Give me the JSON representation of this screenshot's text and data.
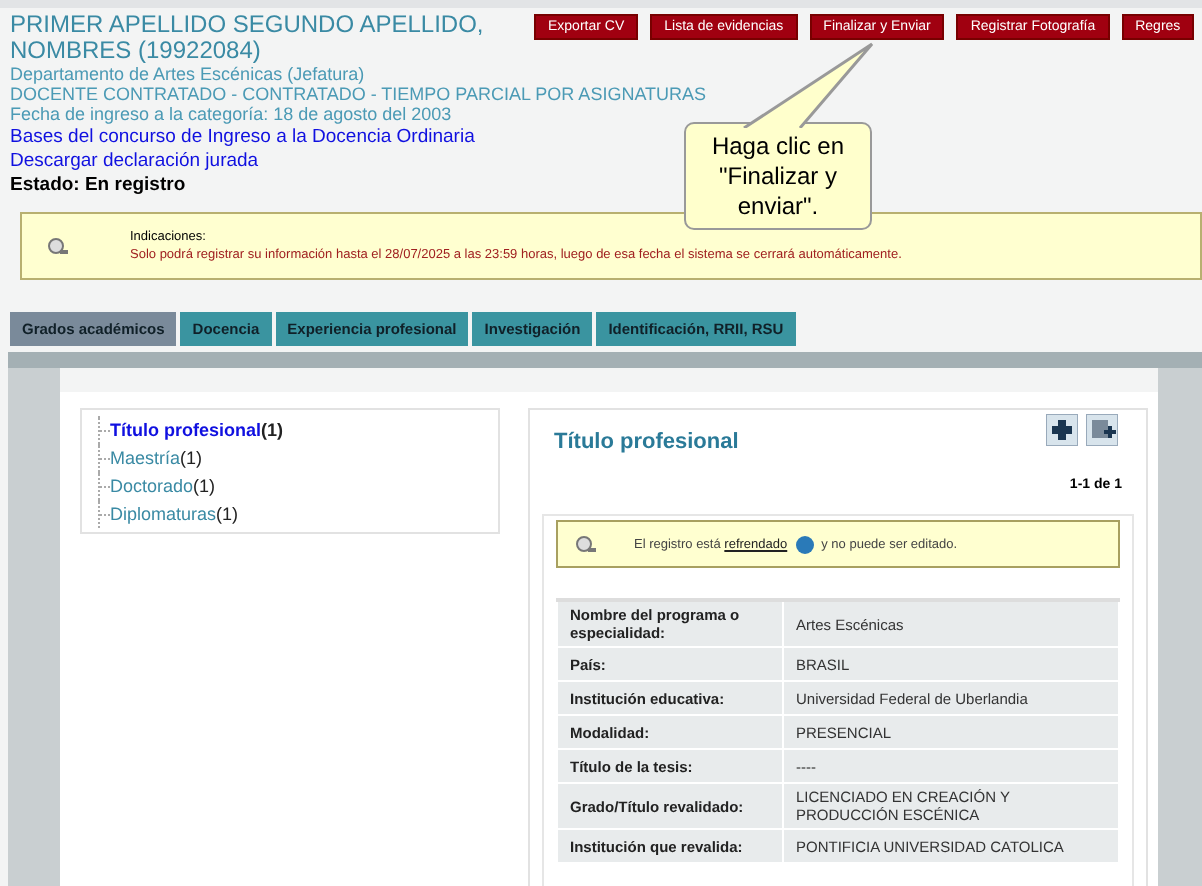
{
  "header": {
    "name": "PRIMER APELLIDO SEGUNDO APELLIDO, NOMBRES (19922084)",
    "department": "Departamento de Artes Escénicas (Jefatura)",
    "position": "DOCENTE CONTRATADO - CONTRATADO - TIEMPO PARCIAL POR ASIGNATURAS",
    "entry_date": "Fecha de ingreso a la categoría: 18 de agosto del 2003",
    "links": [
      "Bases del concurso de Ingreso a la Docencia Ordinaria",
      "Descargar declaración jurada"
    ],
    "status": "Estado: En registro"
  },
  "buttons": [
    "Exportar CV",
    "Lista de evidencias",
    "Finalizar y Enviar",
    "Registrar Fotografía",
    "Regres"
  ],
  "tooltip": "Haga clic en \"Finalizar y enviar\".",
  "notice": {
    "title": "Indicaciones:",
    "text": "Solo podrá registrar su información hasta el 28/07/2025 a las 23:59 horas, luego de esa fecha el sistema se cerrará automáticamente."
  },
  "tabs": [
    {
      "label": "Grados académicos",
      "selected": true
    },
    {
      "label": "Docencia",
      "selected": false
    },
    {
      "label": "Experiencia profesional",
      "selected": false
    },
    {
      "label": "Investigación",
      "selected": false
    },
    {
      "label": "Identificación, RRII, RSU",
      "selected": false
    }
  ],
  "tree": [
    {
      "label": "Título profesional",
      "count": "(1)",
      "selected": true
    },
    {
      "label": "Maestría",
      "count": "(1)",
      "selected": false
    },
    {
      "label": "Doctorado",
      "count": "(1)",
      "selected": false
    },
    {
      "label": "Diplomaturas",
      "count": "(1)",
      "selected": false
    }
  ],
  "panel": {
    "title": "Título profesional",
    "pagination": "1-1 de 1",
    "lock_notice": {
      "before": "El registro está",
      "link": "refrendado",
      "after": "y no puede ser editado."
    },
    "fields": [
      {
        "label": "Nombre del programa o especialidad:",
        "value": "Artes Escénicas"
      },
      {
        "label": "País:",
        "value": "BRASIL"
      },
      {
        "label": "Institución educativa:",
        "value": "Universidad Federal de Uberlandia"
      },
      {
        "label": "Modalidad:",
        "value": "PRESENCIAL"
      },
      {
        "label": "Título de la tesis:",
        "value": "----"
      },
      {
        "label": "Grado/Título revalidado:",
        "value": "LICENCIADO EN CREACIÓN Y PRODUCCIÓN ESCÉNICA"
      },
      {
        "label": "Institución que revalida:",
        "value": "PONTIFICIA UNIVERSIDAD CATOLICA"
      }
    ]
  }
}
